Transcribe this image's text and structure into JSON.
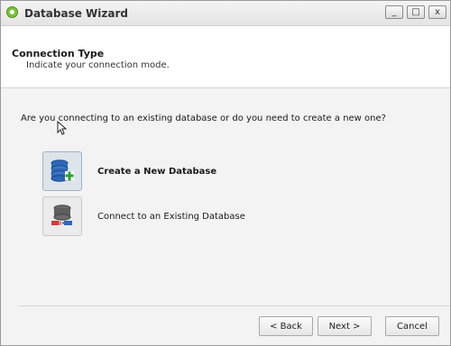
{
  "window": {
    "title": "Database Wizard",
    "controls": {
      "minimize": "_",
      "maximize": "□",
      "close": "x"
    }
  },
  "header": {
    "title": "Connection Type",
    "subtitle": "Indicate your connection mode."
  },
  "main": {
    "question": "Are you connecting to an existing database or do you need to create a new one?",
    "options": [
      {
        "label": "Create a New Database",
        "icon": "database-add-icon",
        "selected": true
      },
      {
        "label": "Connect to an Existing Database",
        "icon": "database-connect-icon",
        "selected": false
      }
    ]
  },
  "footer": {
    "back_label": "< Back",
    "next_label": "Next >",
    "cancel_label": "Cancel"
  },
  "colors": {
    "accent_green": "#7cc242",
    "database_blue": "#2f67b8",
    "plug_red": "#d23a3a"
  }
}
